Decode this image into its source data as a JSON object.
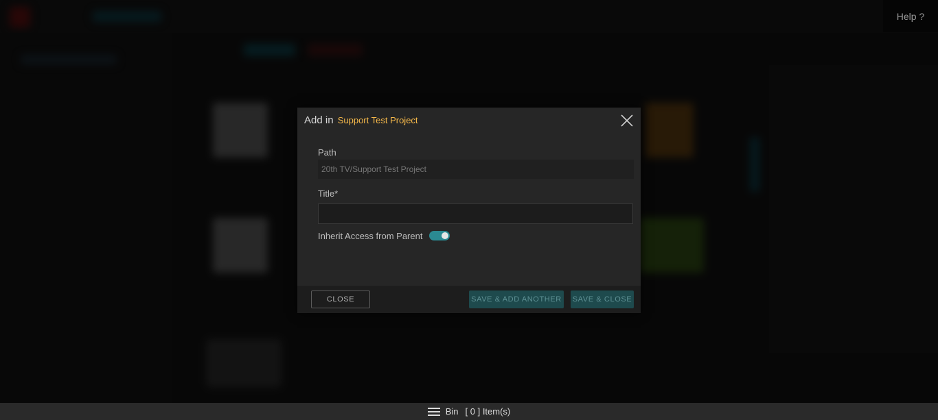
{
  "header": {
    "help_label": "Help ?"
  },
  "modal": {
    "title_prefix": "Add in",
    "project_name": "Support Test Project",
    "path_label": "Path",
    "path_value": "20th TV/Support Test Project",
    "title_label": "Title*",
    "title_value": "",
    "inherit_label": "Inherit Access from Parent",
    "inherit_enabled": true,
    "buttons": {
      "close": "CLOSE",
      "save_add_another": "SAVE & ADD ANOTHER",
      "save_close": "SAVE & CLOSE"
    }
  },
  "bin": {
    "label": "Bin",
    "count_text": "[ 0 ] Item(s)"
  },
  "colors": {
    "accent_teal": "#2b8a92",
    "project_highlight": "#f6b94a",
    "modal_bg": "#262626"
  }
}
